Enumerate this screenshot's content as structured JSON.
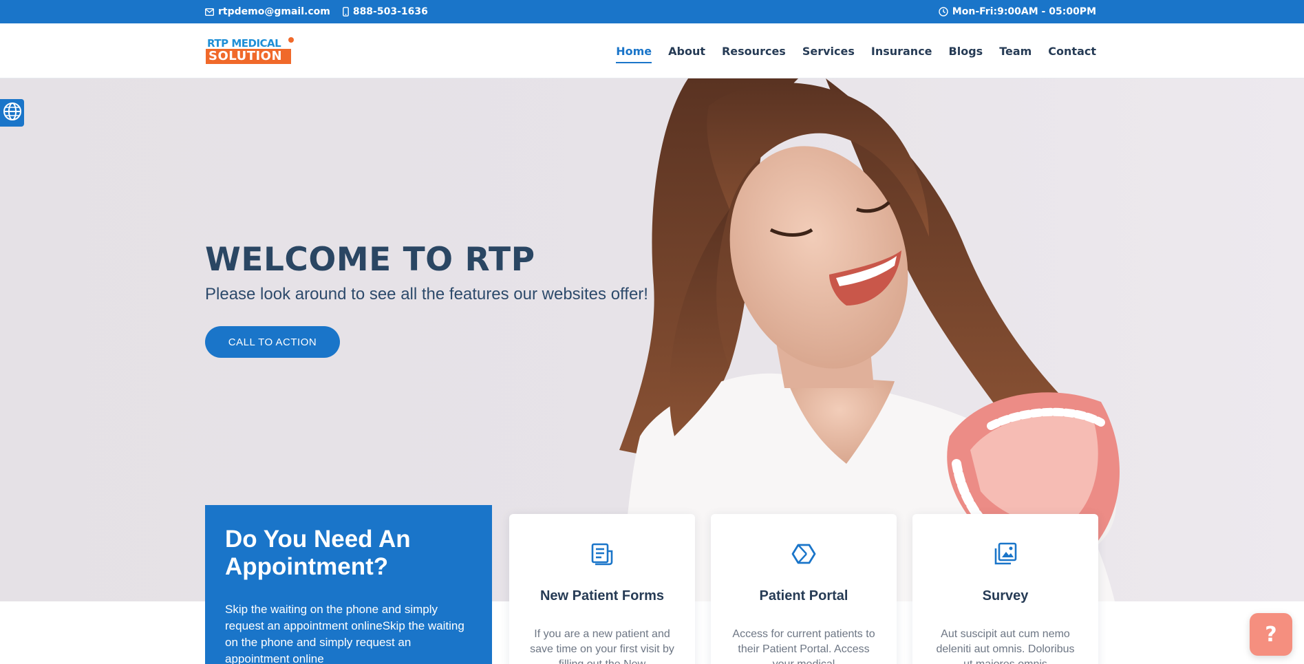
{
  "topbar": {
    "email": "rtpdemo@gmail.com",
    "phone": "888-503-1636",
    "hours": "Mon-Fri:9:00AM - 05:00PM",
    "email_icon": "envelope-icon",
    "phone_icon": "mobile-phone-icon",
    "hours_icon": "clock-icon"
  },
  "logo": {
    "line1": "RTP MEDICAL",
    "line2": "SOLUTION"
  },
  "nav": {
    "items": [
      {
        "label": "Home",
        "active": true
      },
      {
        "label": "About"
      },
      {
        "label": "Resources"
      },
      {
        "label": "Services"
      },
      {
        "label": "Insurance"
      },
      {
        "label": "Blogs"
      },
      {
        "label": "Team"
      },
      {
        "label": "Contact"
      }
    ]
  },
  "hero": {
    "title": "WELCOME TO RTP",
    "subtitle": "Please look around to see all the features our websites offer!",
    "cta_label": "CALL TO ACTION"
  },
  "appointment": {
    "title": "Do You Need An Appointment?",
    "text": "Skip the waiting on the phone and simply request an appointment onlineSkip the waiting on the phone and simply request an appointment online"
  },
  "cards": [
    {
      "icon": "document-form-icon",
      "title": "New Patient Forms",
      "text": "If you are a new patient and save time on your first visit by filling out the New"
    },
    {
      "icon": "hexagon-icon",
      "title": "Patient Portal",
      "text": "Access for current patients to their Patient Portal. Access your medical"
    },
    {
      "icon": "image-gallery-icon",
      "title": "Survey",
      "text": "Aut suscipit aut cum nemo deleniti aut omnis. Doloribus ut maiores omnis"
    }
  ],
  "help": {
    "label": "?"
  },
  "colors": {
    "primary": "#1a75c9",
    "logo_orange": "#f0692a",
    "heading": "#2a4663",
    "help_button": "#f58f7f"
  }
}
